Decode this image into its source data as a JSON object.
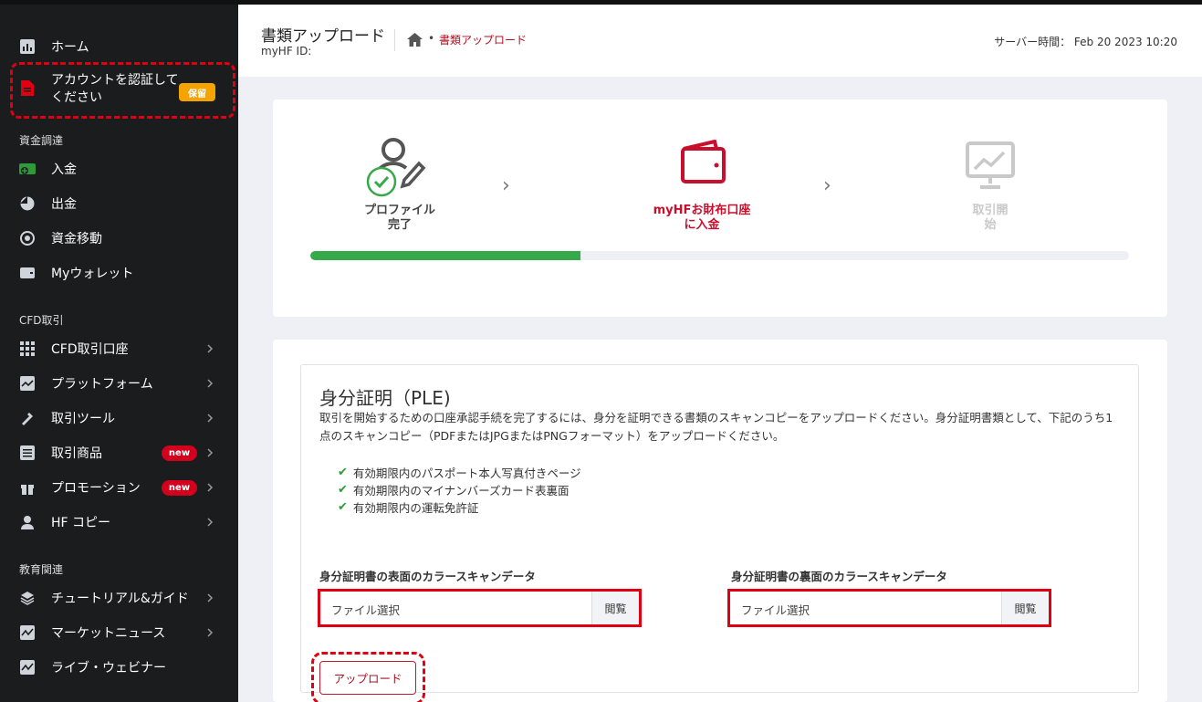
{
  "sidebar": {
    "home": "ホーム",
    "verify": "アカウントを認証してください",
    "verify_badge": "保留",
    "section_funding": "資金調達",
    "deposit": "入金",
    "withdraw": "出金",
    "transfer": "資金移動",
    "wallet": "Myウォレット",
    "section_cfd": "CFD取引",
    "cfd_accounts": "CFD取引口座",
    "platform": "プラットフォーム",
    "tools": "取引ツール",
    "products": "取引商品",
    "products_badge": "new",
    "promotion": "プロモーション",
    "promotion_badge": "new",
    "hfcopy": "HF コピー",
    "section_edu": "教育関連",
    "tutorial": "チュートリアル&ガイド",
    "news": "マーケットニュース",
    "webinar": "ライブ・ウェビナー"
  },
  "header": {
    "title": "書類アップロード",
    "subtitle": "myHF ID:",
    "breadcrumb_dot": "•",
    "breadcrumb_current": "書類アップロード",
    "server_time": "サーバー時間： Feb 20 2023 10:20"
  },
  "progress": {
    "step1_line1": "プロファイル",
    "step1_line2": "完了",
    "step2_line1": "myHFお財布口座",
    "step2_line2": "に入金",
    "step3_line1": "取引開",
    "step3_line2": "始",
    "completion": 0.33,
    "colors": {
      "done": "#36a94a",
      "active": "#c8102e",
      "inactive": "#c9c9c9"
    }
  },
  "identity": {
    "title": "身分証明（PLE)",
    "description": "取引を開始するための口座承認手続を完了するには、身分を証明できる書類のスキャンコピーをアップロードください。身分証明書類として、下記のうち1点のスキャンコピー（PDFまたはJPGまたはPNGフォーマット）をアップロードください。",
    "items": [
      "有効期限内のパスポート本人写真付きページ",
      "有効期限内のマイナンバーズカード表裏面",
      "有効期限内の運転免許証"
    ],
    "front_label": "身分証明書の表面のカラースキャンデータ",
    "back_label": "身分証明書の裏面のカラースキャンデータ",
    "file_placeholder": "ファイル選択",
    "browse": "閲覧",
    "upload": "アップロード"
  }
}
